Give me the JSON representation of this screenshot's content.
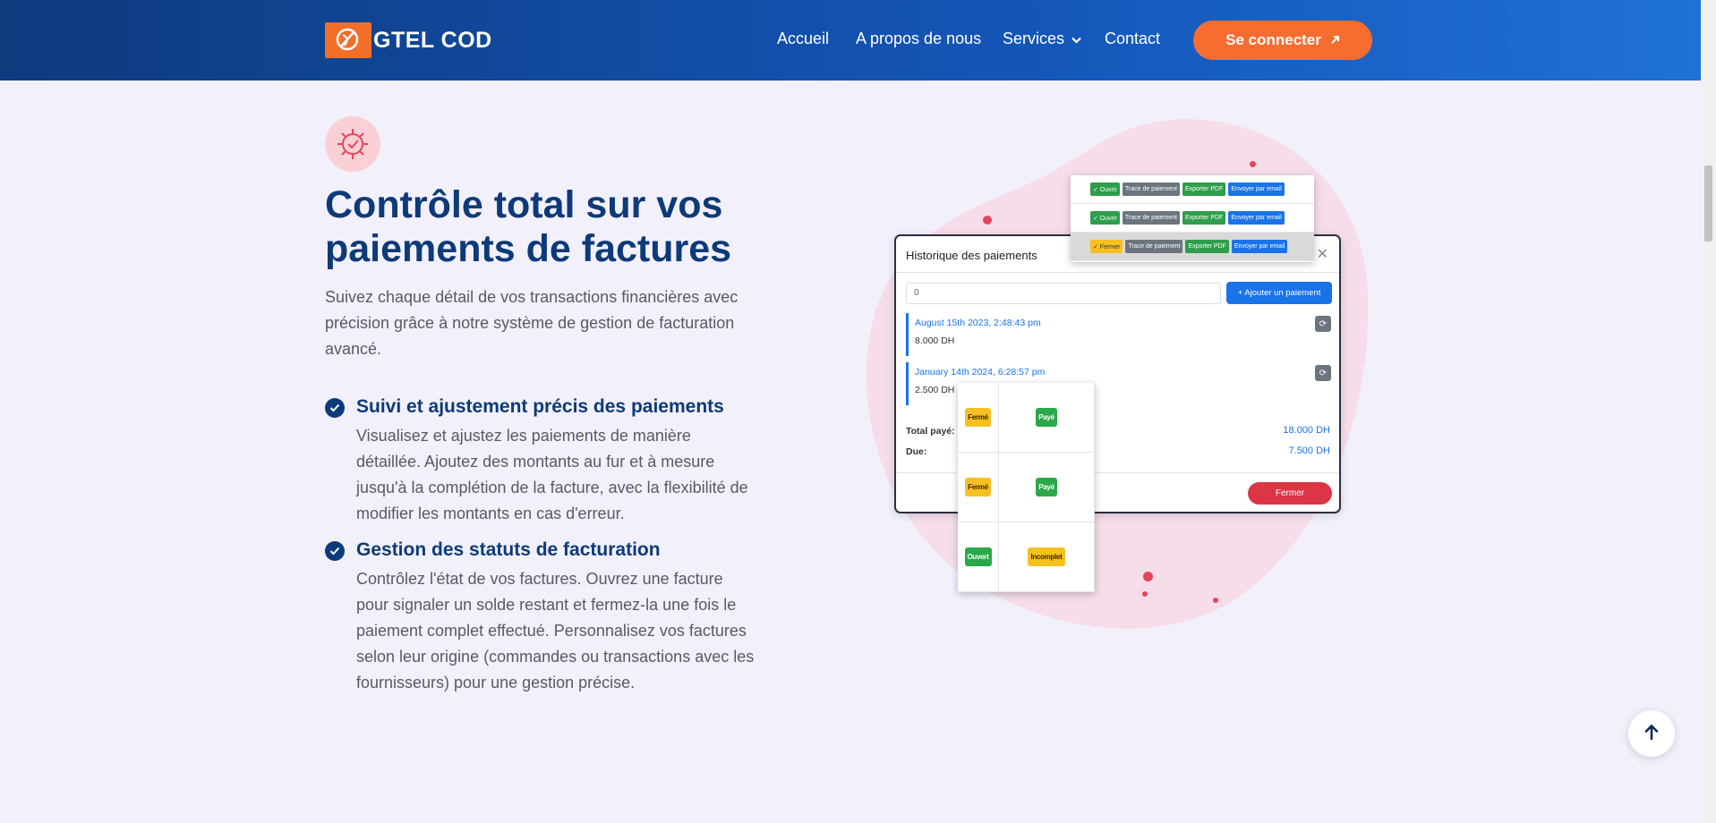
{
  "brand": {
    "name": "GTEL COD",
    "logo_color": "#f26f2a"
  },
  "nav": {
    "items": [
      "Accueil",
      "A propos de nous",
      "Services",
      "Contact"
    ],
    "cta": "Se connecter"
  },
  "section": {
    "heading": "Contrôle total sur vos paiements de factures",
    "lead": "Suivez chaque détail de vos transactions financières avec précision grâce à notre système de gestion de facturation avancé.",
    "features": [
      {
        "title": "Suivi et ajustement précis des paiements",
        "desc": "Visualisez et ajustez les paiements de manière détaillée. Ajoutez des montants au fur et à mesure jusqu'à la complétion de la facture, avec la flexibilité de modifier les montants en cas d'erreur."
      },
      {
        "title": "Gestion des statuts de facturation",
        "desc": "Contrôlez l'état de vos factures. Ouvrez une facture pour signaler un solde restant et fermez-la une fois le paiement complet effectué. Personnalisez vos factures selon leur origine (commandes ou transactions avec les fournisseurs) pour une gestion précise."
      }
    ]
  },
  "illustration": {
    "actions": [
      [
        "✓ Ouvrir",
        "Trace de paiement",
        "Exporter PDF",
        "Envoyer par email"
      ],
      [
        "✓ Ouvrir",
        "Trace de paiement",
        "Exporter PDF",
        "Envoyer par email"
      ],
      [
        "✓ Fermer",
        "Trace de paiement",
        "Exporter PDF",
        "Envoyer par email"
      ]
    ],
    "modal": {
      "title": "Historique des paiements",
      "input_value": "0",
      "add_button": "+ Ajouter un paiement",
      "payments": [
        {
          "date": "August 15th 2023, 2:48:43 pm",
          "amount": "8.000 DH"
        },
        {
          "date": "January 14th 2024, 6:28:57 pm",
          "amount": "2.500 DH"
        }
      ],
      "total_label": "Total payé:",
      "total_value": "18.000 DH",
      "due_label": "Due:",
      "due_value": "7.500 DH",
      "close_button": "Fermer"
    },
    "statuses": [
      [
        "Fermé",
        "Payé"
      ],
      [
        "Fermé",
        "Payé"
      ],
      [
        "Ouvert",
        "Incomplet"
      ]
    ]
  },
  "colors": {
    "accent": "#f76d2f",
    "navy": "#0d3a78",
    "primary": "#1a73e8"
  }
}
